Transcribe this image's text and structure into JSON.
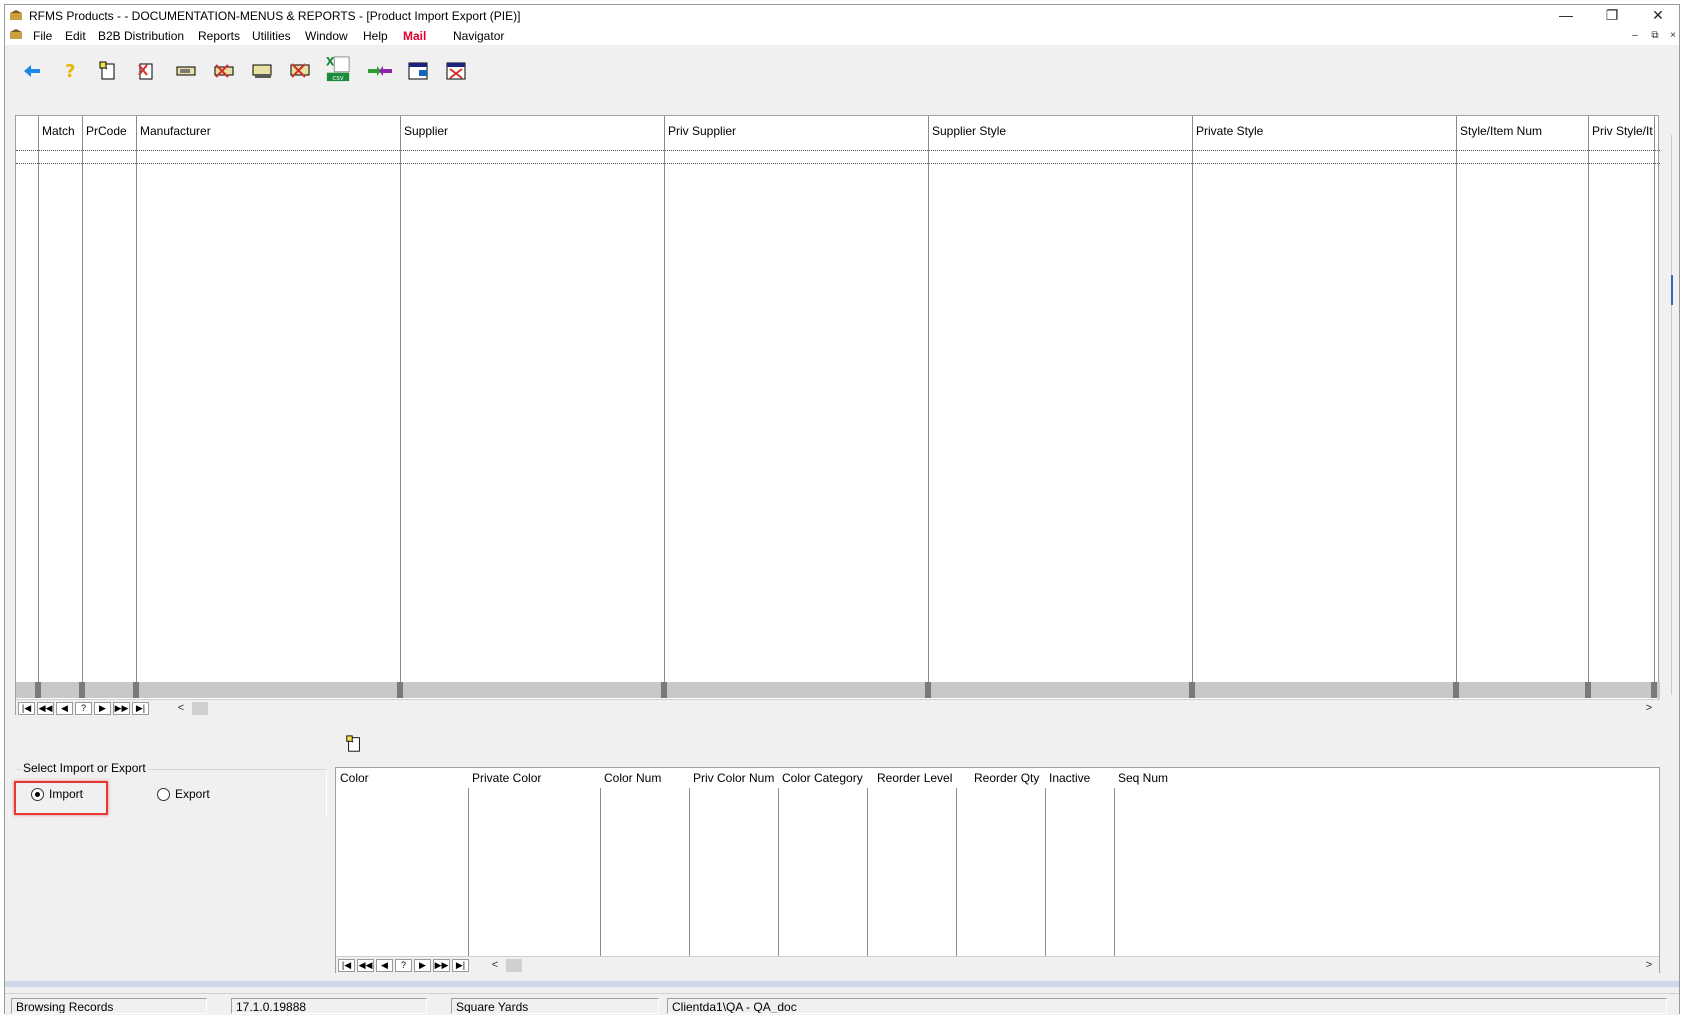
{
  "window": {
    "title": "RFMS Products - - DOCUMENTATION-MENUS & REPORTS - [Product Import Export (PIE)]",
    "minimize": "—",
    "restore": "❐",
    "close": "✕"
  },
  "menu": {
    "items": [
      "File",
      "Edit",
      "B2B Distribution",
      "Reports",
      "Utilities",
      "Window",
      "Help",
      "Mail",
      "Navigator"
    ],
    "mdi_min": "–",
    "mdi_restore": "⧉",
    "mdi_close": "×"
  },
  "toolbar": {
    "buttons": [
      "back-arrow-icon",
      "help-icon",
      "new-record-icon",
      "delete-record-icon",
      "edit-icon",
      "cancel-edit-icon",
      "save-icon",
      "undo-icon",
      "excel-csv-icon",
      "transfer-icon",
      "window-icon",
      "close-window-icon"
    ],
    "csv_label": "CSV",
    "excel_letter": "X"
  },
  "products_grid": {
    "columns": [
      "Match",
      "PrCode",
      "Manufacturer",
      "Supplier",
      "Priv Supplier",
      "Supplier Style",
      "Private Style",
      "Style/Item Num",
      "Priv Style/It"
    ],
    "nav": [
      "|◀",
      "◀◀",
      "◀",
      "?",
      "▶",
      "▶▶",
      "▶|"
    ],
    "scroll_left": "<",
    "scroll_right": ">"
  },
  "import_export": {
    "group_label": "Select Import or Export",
    "import_label": "Import",
    "export_label": "Export",
    "selected": "Import"
  },
  "colors_grid": {
    "columns": [
      "Color",
      "Private Color",
      "Color Num",
      "Priv Color Num",
      "Color Category",
      "Reorder Level",
      "Reorder Qty",
      "Inactive",
      "Seq Num"
    ],
    "nav": [
      "|◀",
      "◀◀",
      "◀",
      "?",
      "▶",
      "▶▶",
      "▶|"
    ],
    "scroll_left": "<",
    "scroll_right": ">"
  },
  "status": {
    "mode": "Browsing Records",
    "version": "17.1.0.19888",
    "unit": "Square Yards",
    "db": "Clientda1\\QA - QA_doc"
  },
  "colors": {
    "highlight": "#e53935",
    "mail": "#e4002b"
  }
}
